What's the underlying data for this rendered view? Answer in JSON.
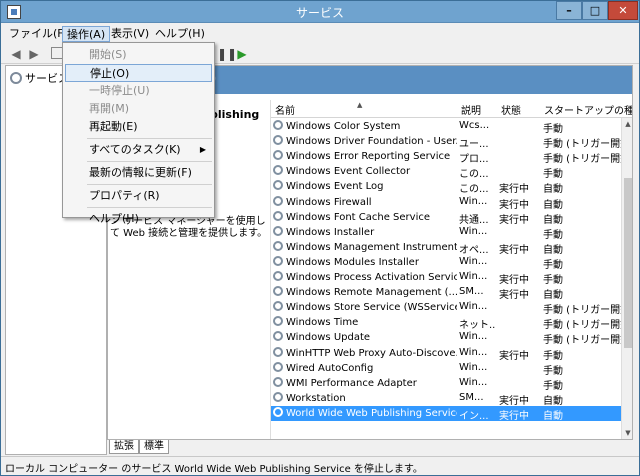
{
  "window": {
    "title": "サービス"
  },
  "menubar": [
    {
      "label": "ファイル(F)"
    },
    {
      "label": "操作(A)"
    },
    {
      "label": "表示(V)"
    },
    {
      "label": "ヘルプ(H)"
    }
  ],
  "tree": {
    "root_label": "サービス ("
  },
  "content": {
    "header": ")",
    "desc_title_fragment": "blishing",
    "desc_text": "ン サービス マネージャーを使用して Web 接続と管理を提供します。"
  },
  "list": {
    "columns": {
      "name": "名前",
      "desc": "説明",
      "status": "状態",
      "startup": "スタートアップの種"
    },
    "rows": [
      {
        "name": "Windows Color System",
        "desc": "Wcs...",
        "status": "",
        "startup": "手動"
      },
      {
        "name": "Windows Driver Foundation - User...",
        "desc": "ユー...",
        "status": "",
        "startup": "手動 (トリガー開始)"
      },
      {
        "name": "Windows Error Reporting Service",
        "desc": "プロ...",
        "status": "",
        "startup": "手動 (トリガー開始)"
      },
      {
        "name": "Windows Event Collector",
        "desc": "この...",
        "status": "",
        "startup": "手動"
      },
      {
        "name": "Windows Event Log",
        "desc": "この...",
        "status": "実行中",
        "startup": "自動"
      },
      {
        "name": "Windows Firewall",
        "desc": "Win...",
        "status": "実行中",
        "startup": "自動"
      },
      {
        "name": "Windows Font Cache Service",
        "desc": "共通...",
        "status": "実行中",
        "startup": "自動"
      },
      {
        "name": "Windows Installer",
        "desc": "Win...",
        "status": "",
        "startup": "手動"
      },
      {
        "name": "Windows Management Instrument...",
        "desc": "オペ...",
        "status": "実行中",
        "startup": "自動"
      },
      {
        "name": "Windows Modules Installer",
        "desc": "Win...",
        "status": "",
        "startup": "手動"
      },
      {
        "name": "Windows Process Activation Service",
        "desc": "Win...",
        "status": "実行中",
        "startup": "手動"
      },
      {
        "name": "Windows Remote Management (...",
        "desc": "SM...",
        "status": "実行中",
        "startup": "自動"
      },
      {
        "name": "Windows Store Service (WSService)",
        "desc": "Win...",
        "status": "",
        "startup": "手動 (トリガー開始)"
      },
      {
        "name": "Windows Time",
        "desc": "ネット...",
        "status": "",
        "startup": "手動 (トリガー開始)"
      },
      {
        "name": "Windows Update",
        "desc": "Win...",
        "status": "",
        "startup": "手動 (トリガー開始)"
      },
      {
        "name": "WinHTTP Web Proxy Auto-Discove...",
        "desc": "Win...",
        "status": "実行中",
        "startup": "手動"
      },
      {
        "name": "Wired AutoConfig",
        "desc": "Win...",
        "status": "",
        "startup": "手動"
      },
      {
        "name": "WMI Performance Adapter",
        "desc": "Win...",
        "status": "",
        "startup": "手動"
      },
      {
        "name": "Workstation",
        "desc": "SM...",
        "status": "実行中",
        "startup": "自動"
      },
      {
        "name": "World Wide Web Publishing Service",
        "desc": "イン...",
        "status": "実行中",
        "startup": "自動",
        "selected": true
      }
    ]
  },
  "tabs": [
    {
      "label": "拡張"
    },
    {
      "label": "標準"
    }
  ],
  "statusbar": {
    "text": "ローカル コンピューター のサービス World Wide Web Publishing Service を停止します。"
  },
  "dropdown": {
    "items": [
      {
        "label": "開始(S)",
        "disabled": true
      },
      {
        "label": "停止(O)",
        "hover": true
      },
      {
        "label": "一時停止(U)",
        "disabled": true
      },
      {
        "label": "再開(M)",
        "disabled": true
      },
      {
        "label": "再起動(E)"
      },
      {
        "separator": true
      },
      {
        "label": "すべてのタスク(K)",
        "submenu": true
      },
      {
        "separator": true
      },
      {
        "label": "最新の情報に更新(F)"
      },
      {
        "separator": true
      },
      {
        "label": "プロパティ(R)"
      },
      {
        "separator": true
      },
      {
        "label": "ヘルプ(H)"
      }
    ]
  }
}
